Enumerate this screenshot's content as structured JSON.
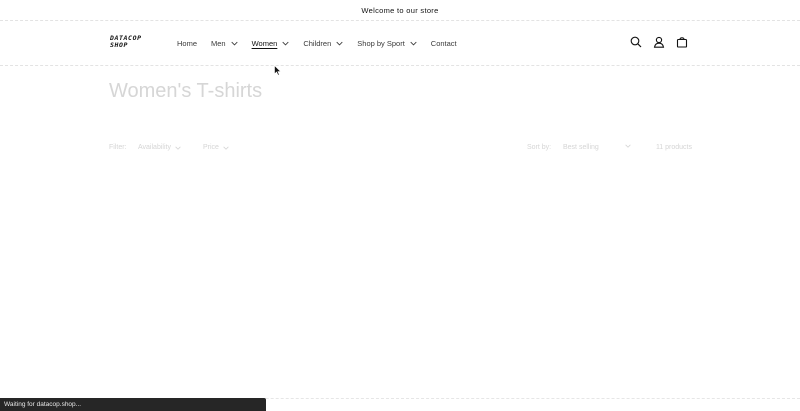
{
  "announcement": {
    "text": "Welcome to our store"
  },
  "logo": {
    "line1": "DATACOP",
    "line2": "SHOP"
  },
  "nav": [
    {
      "label": "Home",
      "has_dropdown": false,
      "active": false
    },
    {
      "label": "Men",
      "has_dropdown": true,
      "active": false
    },
    {
      "label": "Women",
      "has_dropdown": true,
      "active": true
    },
    {
      "label": "Children",
      "has_dropdown": true,
      "active": false
    },
    {
      "label": "Shop by Sport",
      "has_dropdown": true,
      "active": false
    },
    {
      "label": "Contact",
      "has_dropdown": false,
      "active": false
    }
  ],
  "header_icons": [
    "search-icon",
    "account-icon",
    "cart-icon"
  ],
  "collection": {
    "title": "Women's T-shirts"
  },
  "filters": {
    "label": "Filter:",
    "availability": "Availability",
    "price": "Price",
    "sort_label": "Sort by:",
    "sort_value": "Best selling",
    "count": "11 products"
  },
  "status_bar": {
    "text": "Waiting for datacop.shop..."
  }
}
